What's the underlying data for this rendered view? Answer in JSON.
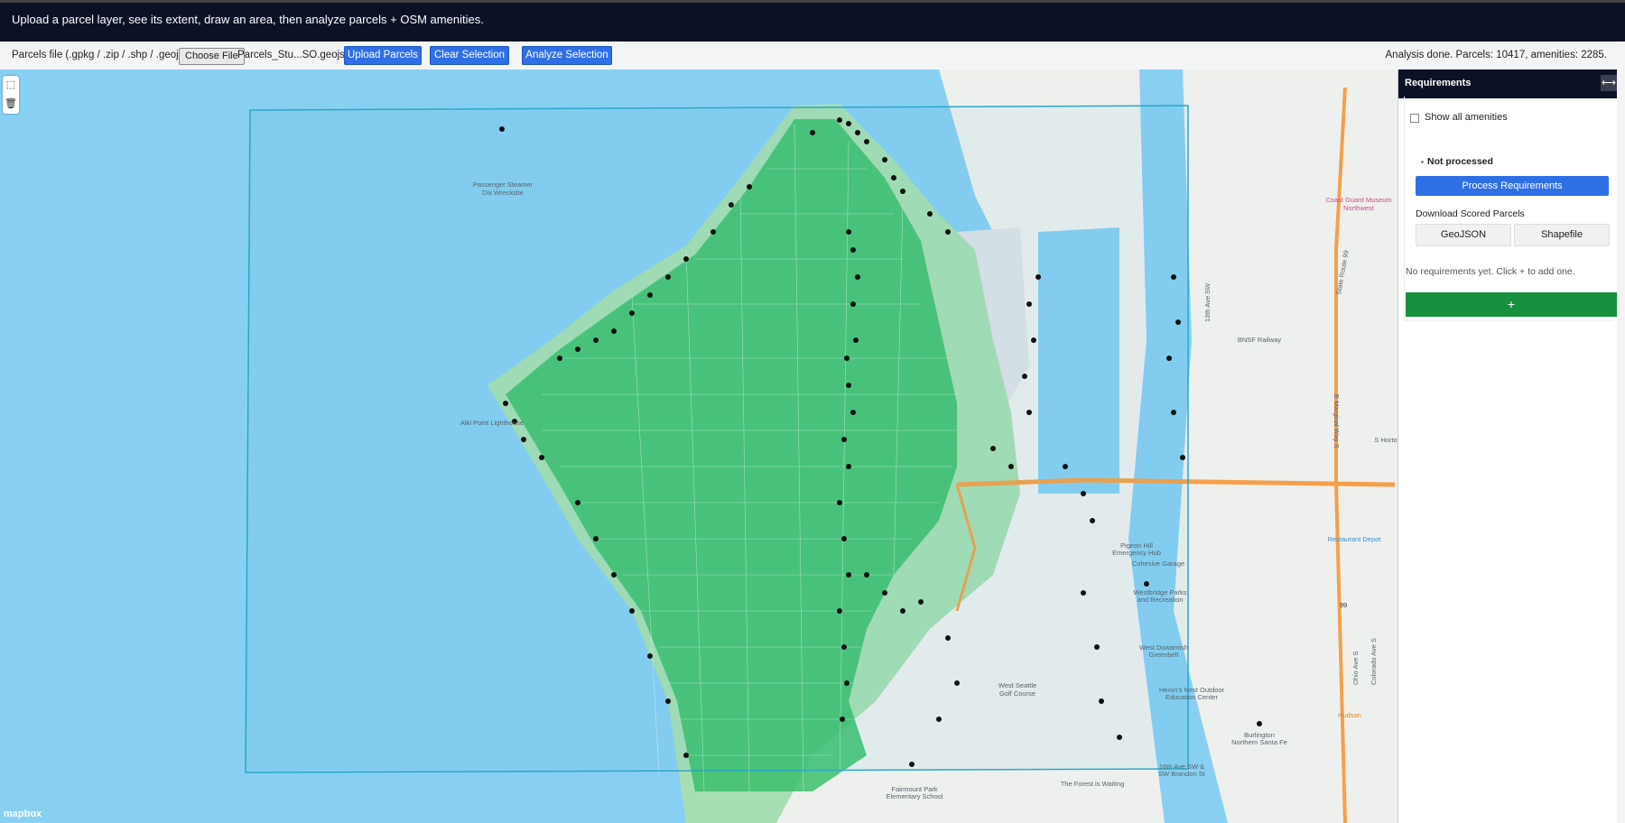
{
  "header": {
    "instructions": "Upload a parcel layer, see its extent, draw an area, then analyze parcels + OSM amenities."
  },
  "toolbar": {
    "file_label": "Parcels file (.gpkg / .zip / .shp / .geojson):",
    "choose_file": "Choose File",
    "file_name": "Parcels_Stu...SO.geojson",
    "upload": "Upload Parcels",
    "clear": "Clear Selection",
    "analyze": "Analyze Selection",
    "status": "Analysis done. Parcels: 10417, amenities: 2285."
  },
  "map": {
    "attribution": "mapbox",
    "draw_controls": [
      {
        "name": "polygon-draw-icon",
        "glyph": "⬚"
      },
      {
        "name": "trash-icon",
        "glyph": "🗑"
      }
    ],
    "labels": {
      "wreck": "Passenger Steamer",
      "wreck2": "Dix Wreckslte",
      "alki": "Alki Point Lighthouse",
      "museum": "Coast Guard Museum",
      "museum2": "Northwest",
      "restaurant": "Restaurant Depot",
      "hudson": "Hudson",
      "state_route": "State Route 99",
      "marginal": "E Marginal Way S",
      "bnsf": "BNSF Railway",
      "school": "Fairmount Park",
      "school2": "Elementary School",
      "golf": "West Seattle",
      "golf2": "Golf Course",
      "burlington": "Burlington",
      "burlington2": "Northern Santa Fe",
      "hortonview": "S Horto",
      "duwamish": "West Duwamish",
      "duwamish2": "Greenbelt",
      "pigeon": "Pigeon Hill",
      "pigeon2": "Emergency Hub",
      "cohesive": "Cohesive Garage",
      "westbridge": "Westbridge Parks",
      "westbridge2": "and Recreation",
      "herons": "Heron's Nest Outdoor",
      "herons2": "Education Center",
      "ave16": "16th Ave SW &",
      "ave16b": "SW Brandon St",
      "forest": "The Forest is Waiting",
      "ave13": "13th Ave SW",
      "oxford": "Ohio Ave S",
      "colorado": "Colorado Ave S",
      "route99": "99"
    }
  },
  "panel": {
    "title": "Requirements",
    "toggle_icon": "⟷",
    "show_all": "Show all amenities",
    "status": "Not processed",
    "process": "Process Requirements",
    "download_heading": "Download Scored Parcels",
    "geojson": "GeoJSON",
    "shapefile": "Shapefile",
    "empty": "No requirements yet. Click + to add one.",
    "add": "+"
  },
  "colors": {
    "water": "#88d0f2",
    "parcels": "#3bbf6a",
    "land": "#eef0ee",
    "selection": "#2aa7c8",
    "amenity": "#111111",
    "primary_button": "#2f6fe4",
    "add_button": "#18913f",
    "header_bg": "#0b1226"
  }
}
